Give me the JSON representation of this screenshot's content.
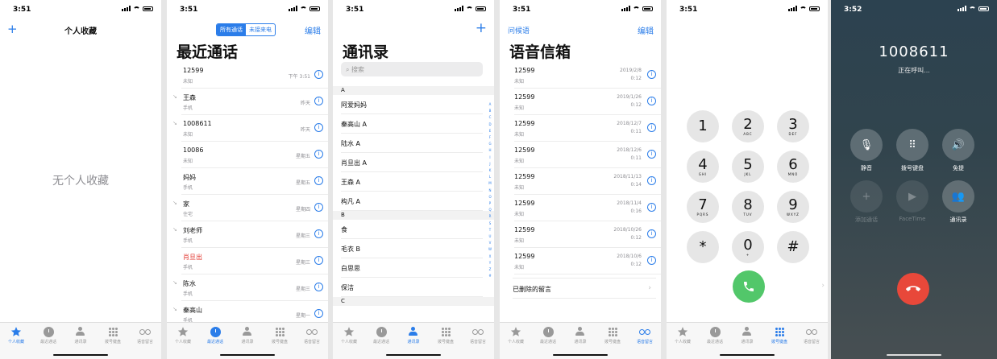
{
  "status_time": "3:51",
  "status_time_call": "3:52",
  "colors": {
    "accent": "#2b7de9",
    "missed": "#e0322b",
    "call_green": "#52c76a",
    "end_red": "#e8483a"
  },
  "tabs": [
    "个人收藏",
    "最近通话",
    "通讯录",
    "拨号键盘",
    "语音留言"
  ],
  "favorites": {
    "title": "个人收藏",
    "add_label": "+",
    "empty_text": "无个人收藏"
  },
  "recents": {
    "title": "最近通话",
    "segments": [
      "所有通话",
      "未接来电"
    ],
    "edit_label": "编辑",
    "items": [
      {
        "name": "12599",
        "sub": "未知",
        "date": "下午 3:51",
        "missed": false,
        "icon": false
      },
      {
        "name": "王森",
        "sub": "手机",
        "date": "昨天",
        "missed": false,
        "icon": true
      },
      {
        "name": "1008611",
        "sub": "未知",
        "date": "昨天",
        "missed": false,
        "icon": true
      },
      {
        "name": "10086",
        "sub": "未知",
        "date": "星期五",
        "missed": false,
        "icon": false
      },
      {
        "name": "妈妈",
        "sub": "手机",
        "date": "星期五",
        "missed": false,
        "icon": false
      },
      {
        "name": "家",
        "sub": "住宅",
        "date": "星期四",
        "missed": false,
        "icon": true
      },
      {
        "name": "刘老师",
        "sub": "手机",
        "date": "星期三",
        "missed": false,
        "icon": true
      },
      {
        "name": "肖旦出",
        "sub": "手机",
        "date": "星期三",
        "missed": true,
        "icon": false
      },
      {
        "name": "陈水",
        "sub": "手机",
        "date": "星期三",
        "missed": false,
        "icon": true
      },
      {
        "name": "秦高山",
        "sub": "手机",
        "date": "星期一",
        "missed": false,
        "icon": true
      }
    ]
  },
  "contacts": {
    "title": "通讯录",
    "add_label": "+",
    "search_placeholder": "搜索",
    "sections": [
      {
        "letter": "A",
        "names": [
          "阿爱妈妈",
          "秦高山 A",
          "陆水 A",
          "肖旦出 A",
          "王森 A",
          "构凡 A"
        ]
      },
      {
        "letter": "B",
        "names": [
          "食",
          "毛衣 B",
          "白思思",
          "保洁"
        ]
      },
      {
        "letter": "C",
        "names": []
      }
    ],
    "index": [
      "A",
      "B",
      "C",
      "D",
      "E",
      "F",
      "G",
      "H",
      "I",
      "J",
      "K",
      "L",
      "M",
      "N",
      "O",
      "P",
      "Q",
      "R",
      "S",
      "T",
      "U",
      "V",
      "W",
      "X",
      "Y",
      "Z",
      "#"
    ]
  },
  "voicemail": {
    "title": "语音信箱",
    "greeting_label": "问候语",
    "edit_label": "编辑",
    "items": [
      {
        "num": "12599",
        "sub": "未知",
        "date": "2019/2/8",
        "dur": "0:12"
      },
      {
        "num": "12599",
        "sub": "未知",
        "date": "2019/1/26",
        "dur": "0:12"
      },
      {
        "num": "12599",
        "sub": "未知",
        "date": "2018/12/7",
        "dur": "0:11"
      },
      {
        "num": "12599",
        "sub": "未知",
        "date": "2018/12/6",
        "dur": "0:11"
      },
      {
        "num": "12599",
        "sub": "未知",
        "date": "2018/11/13",
        "dur": "0:14"
      },
      {
        "num": "12599",
        "sub": "未知",
        "date": "2018/11/4",
        "dur": "0:16"
      },
      {
        "num": "12599",
        "sub": "未知",
        "date": "2018/10/26",
        "dur": "0:12"
      },
      {
        "num": "12599",
        "sub": "未知",
        "date": "2018/10/6",
        "dur": "0:12"
      }
    ],
    "deleted_label": "已删除的留言"
  },
  "keypad": {
    "keys": [
      {
        "n": "1",
        "l": ""
      },
      {
        "n": "2",
        "l": "ABC"
      },
      {
        "n": "3",
        "l": "DEF"
      },
      {
        "n": "4",
        "l": "GHI"
      },
      {
        "n": "5",
        "l": "JKL"
      },
      {
        "n": "6",
        "l": "MNO"
      },
      {
        "n": "7",
        "l": "PQRS"
      },
      {
        "n": "8",
        "l": "TUV"
      },
      {
        "n": "9",
        "l": "WXYZ"
      },
      {
        "n": "*",
        "l": ""
      },
      {
        "n": "0",
        "l": "+"
      },
      {
        "n": "#",
        "l": ""
      }
    ]
  },
  "call": {
    "number": "1008611",
    "status": "正在呼叫...",
    "buttons": [
      {
        "label": "静音",
        "icon": "mic-icon",
        "glyph": "🎙",
        "dim": false
      },
      {
        "label": "拨号键盘",
        "icon": "keypad-icon",
        "glyph": "⠿",
        "dim": false
      },
      {
        "label": "免提",
        "icon": "speaker-icon",
        "glyph": "🔊",
        "dim": false
      },
      {
        "label": "添加通话",
        "icon": "add-call-icon",
        "glyph": "+",
        "dim": true
      },
      {
        "label": "FaceTime",
        "icon": "facetime-icon",
        "glyph": "▶",
        "dim": true
      },
      {
        "label": "通讯录",
        "icon": "contacts-icon",
        "glyph": "👥",
        "dim": false
      }
    ]
  }
}
